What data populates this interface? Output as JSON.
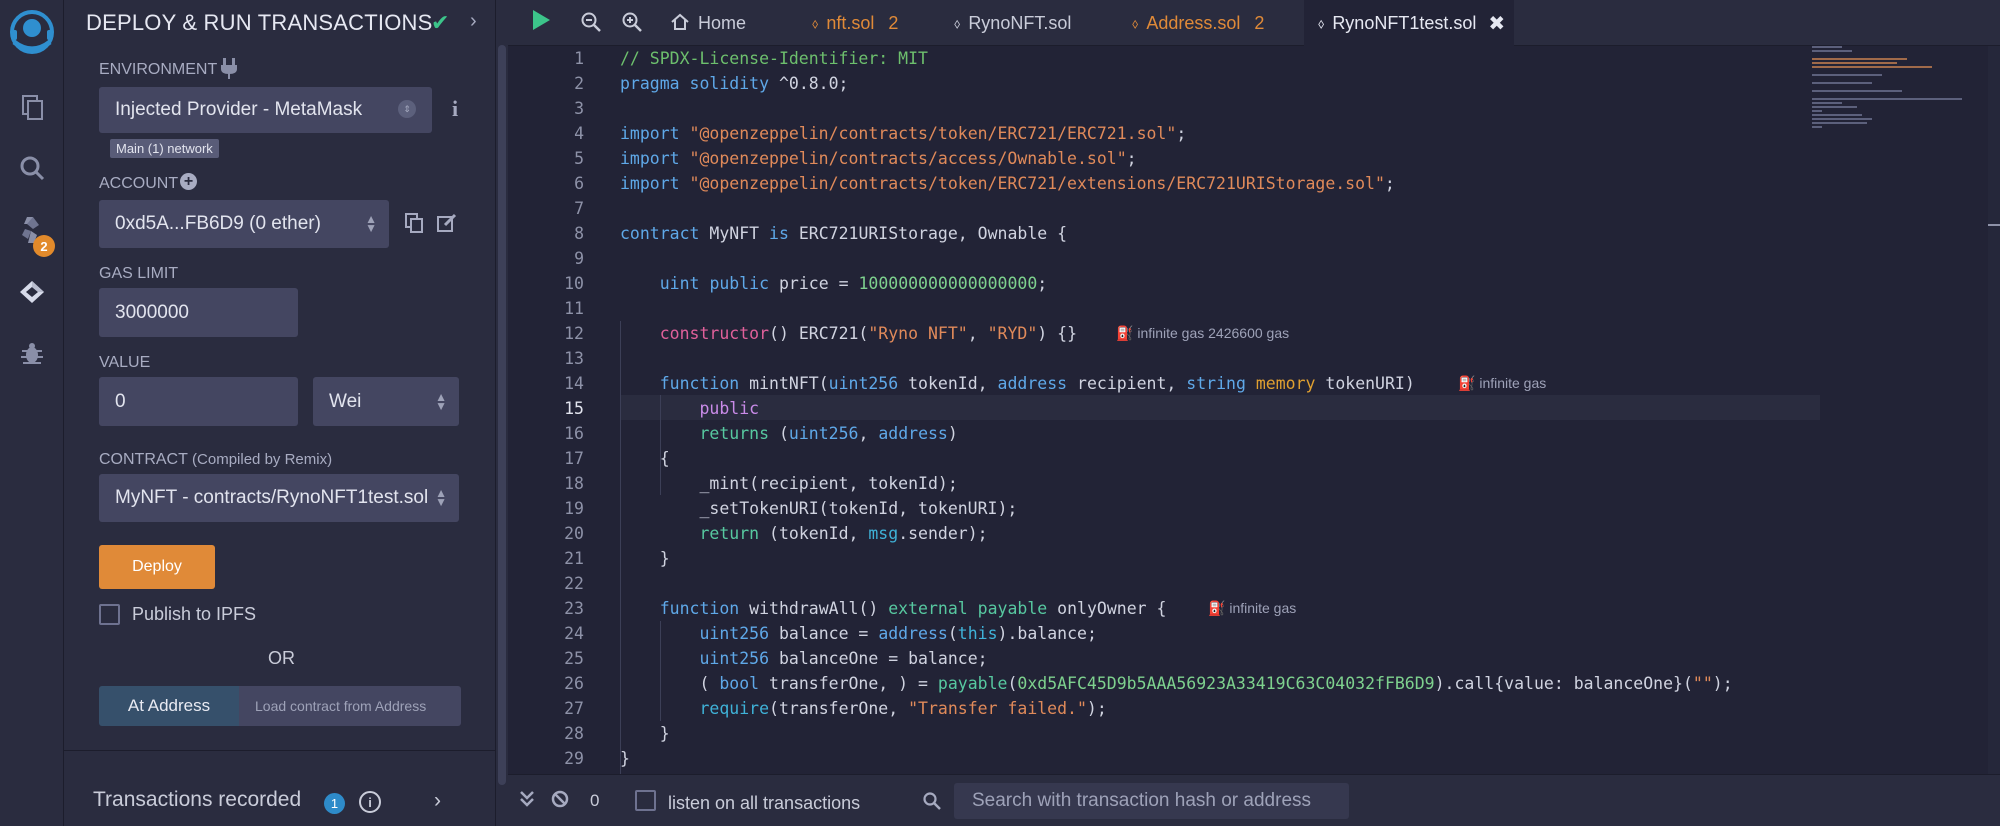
{
  "iconbar": {
    "icons": [
      "remix-logo-icon",
      "file-explorer-icon",
      "search-icon",
      "solidity-compiler-icon",
      "deploy-run-icon",
      "debugger-icon"
    ],
    "compiler_badge": "2"
  },
  "panel": {
    "title": "DEPLOY & RUN TRANSACTIONS",
    "environment_label": "ENVIRONMENT",
    "environment_value": "Injected Provider - MetaMask",
    "network_tag": "Main (1) network",
    "account_label": "ACCOUNT",
    "account_value": "0xd5A...FB6D9 (0 ether)",
    "gas_limit_label": "GAS LIMIT",
    "gas_limit_value": "3000000",
    "value_label": "VALUE",
    "value_amount": "0",
    "value_unit": "Wei",
    "contract_label": "CONTRACT",
    "contract_sublabel": "(Compiled by Remix)",
    "contract_value": "MyNFT - contracts/RynoNFT1test.sol",
    "deploy_label": "Deploy",
    "publish_label": "Publish to IPFS",
    "or_label": "OR",
    "at_address_label": "At Address",
    "at_address_placeholder": "Load contract from Address",
    "transactions_label": "Transactions recorded",
    "transactions_count": "1"
  },
  "tabs": [
    {
      "label": "Home",
      "icon": "home-icon",
      "num": ""
    },
    {
      "label": "nft.sol",
      "icon": "solidity-icon",
      "num": "2"
    },
    {
      "label": "RynoNFT.sol",
      "icon": "solidity-icon",
      "num": ""
    },
    {
      "label": "Address.sol",
      "icon": "solidity-icon",
      "num": "2"
    },
    {
      "label": "RynoNFT1test.sol",
      "icon": "solidity-icon",
      "num": ""
    }
  ],
  "code": {
    "current_line": "15",
    "gas": {
      "ctor": "infinite gas 2426600 gas",
      "mint": "infinite gas",
      "withdraw": "infinite gas"
    }
  },
  "terminal": {
    "count": "0",
    "listen_label": "listen on all transactions",
    "search_placeholder": "Search with transaction hash or address"
  },
  "colors": {
    "background": "#222336",
    "panel": "#2a2c3f",
    "accent_orange": "#e08a38",
    "check_green": "#3cc48a"
  }
}
